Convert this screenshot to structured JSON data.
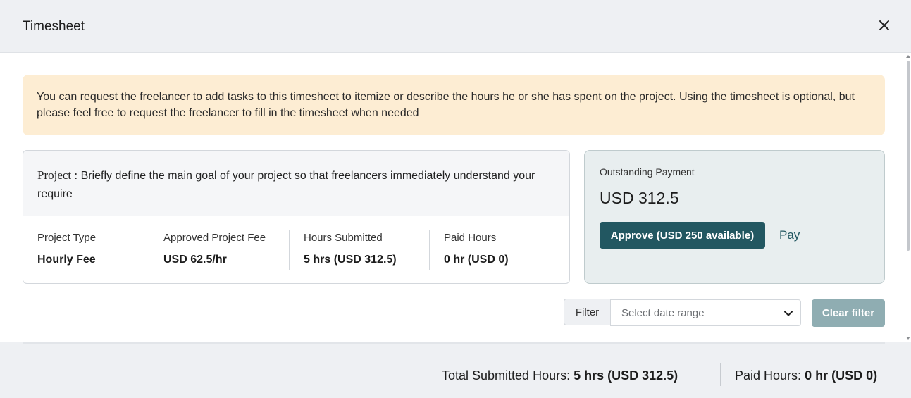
{
  "dialog": {
    "title": "Timesheet"
  },
  "notice": {
    "text": "You can request the freelancer to add tasks to this timesheet to itemize or describe the hours he or she has spent on the project. Using the timesheet is optional, but please feel free to request the freelancer to fill in the timesheet when needed"
  },
  "project": {
    "label": "Project :",
    "description": "Briefly define the main goal of your project so that freelancers immediately understand your require"
  },
  "stats": [
    {
      "label": "Project Type",
      "value": "Hourly Fee"
    },
    {
      "label": "Approved Project Fee",
      "value": "USD 62.5/hr"
    },
    {
      "label": "Hours Submitted",
      "value": "5 hrs (USD 312.5)"
    },
    {
      "label": "Paid Hours",
      "value": "0 hr (USD 0)"
    }
  ],
  "payment": {
    "label": "Outstanding Payment",
    "amount": "USD 312.5",
    "approve_label": "Approve (USD 250 available)",
    "pay_label": "Pay"
  },
  "filter": {
    "label": "Filter",
    "placeholder": "Select date range",
    "clear_label": "Clear filter"
  },
  "footer": {
    "total_label": "Total Submitted Hours:",
    "total_value": "5 hrs (USD 312.5)",
    "paid_label": "Paid Hours:",
    "paid_value": "0 hr (USD 0)"
  },
  "colors": {
    "accent": "#225761",
    "notice_bg": "#fdedd3",
    "clear_button": "#8fadb2"
  },
  "icons": {
    "close": "close-icon",
    "dropdown": "chevron-down-icon"
  }
}
